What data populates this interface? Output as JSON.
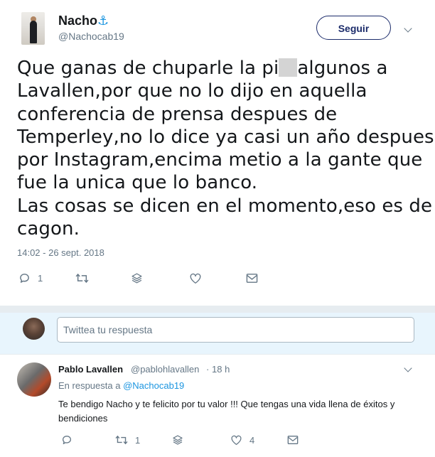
{
  "tweet": {
    "author_name": "Nacho",
    "author_emoji": "⚓",
    "author_handle": "@Nachocab19",
    "follow_label": "Seguir",
    "text_lines": [
      [
        "Que ganas de chuparle la pi",
        "algunos a"
      ],
      "Lavallen,por que no lo dijo en aquella",
      "conferencia de prensa despues de",
      "Temperley,no lo dice ya casi un año despues y",
      "por Instagram,encima metio a la gante que",
      "fue la unica que lo banco.",
      "Las cosas se dicen en el momento,eso es de",
      "cagon."
    ],
    "timestamp": "14:02 - 26 sept. 2018",
    "reply_count": "1"
  },
  "reply_box": {
    "placeholder": "Twittea tu respuesta"
  },
  "reply": {
    "author_name": "Pablo Lavallen",
    "author_handle": "@pablohlavallen",
    "separator": "·",
    "time": "18 h",
    "in_reply_prefix": "En respuesta a",
    "in_reply_handle": "@Nachocab19",
    "text": "Te bendigo Nacho y te felicito por tu valor !!! Que tengas una vida llena de éxitos y bendiciones",
    "reply_count": "",
    "retweet_count": "1",
    "like_count": "4"
  },
  "icons": [
    "reply-icon",
    "retweet-icon",
    "stack-icon",
    "heart-icon",
    "message-icon",
    "chevron-down-icon"
  ],
  "colors": {
    "accent": "#1b95e0",
    "follow_border": "#1b2b6a",
    "muted": "#657786",
    "reply_bg": "#e8f5fd"
  }
}
